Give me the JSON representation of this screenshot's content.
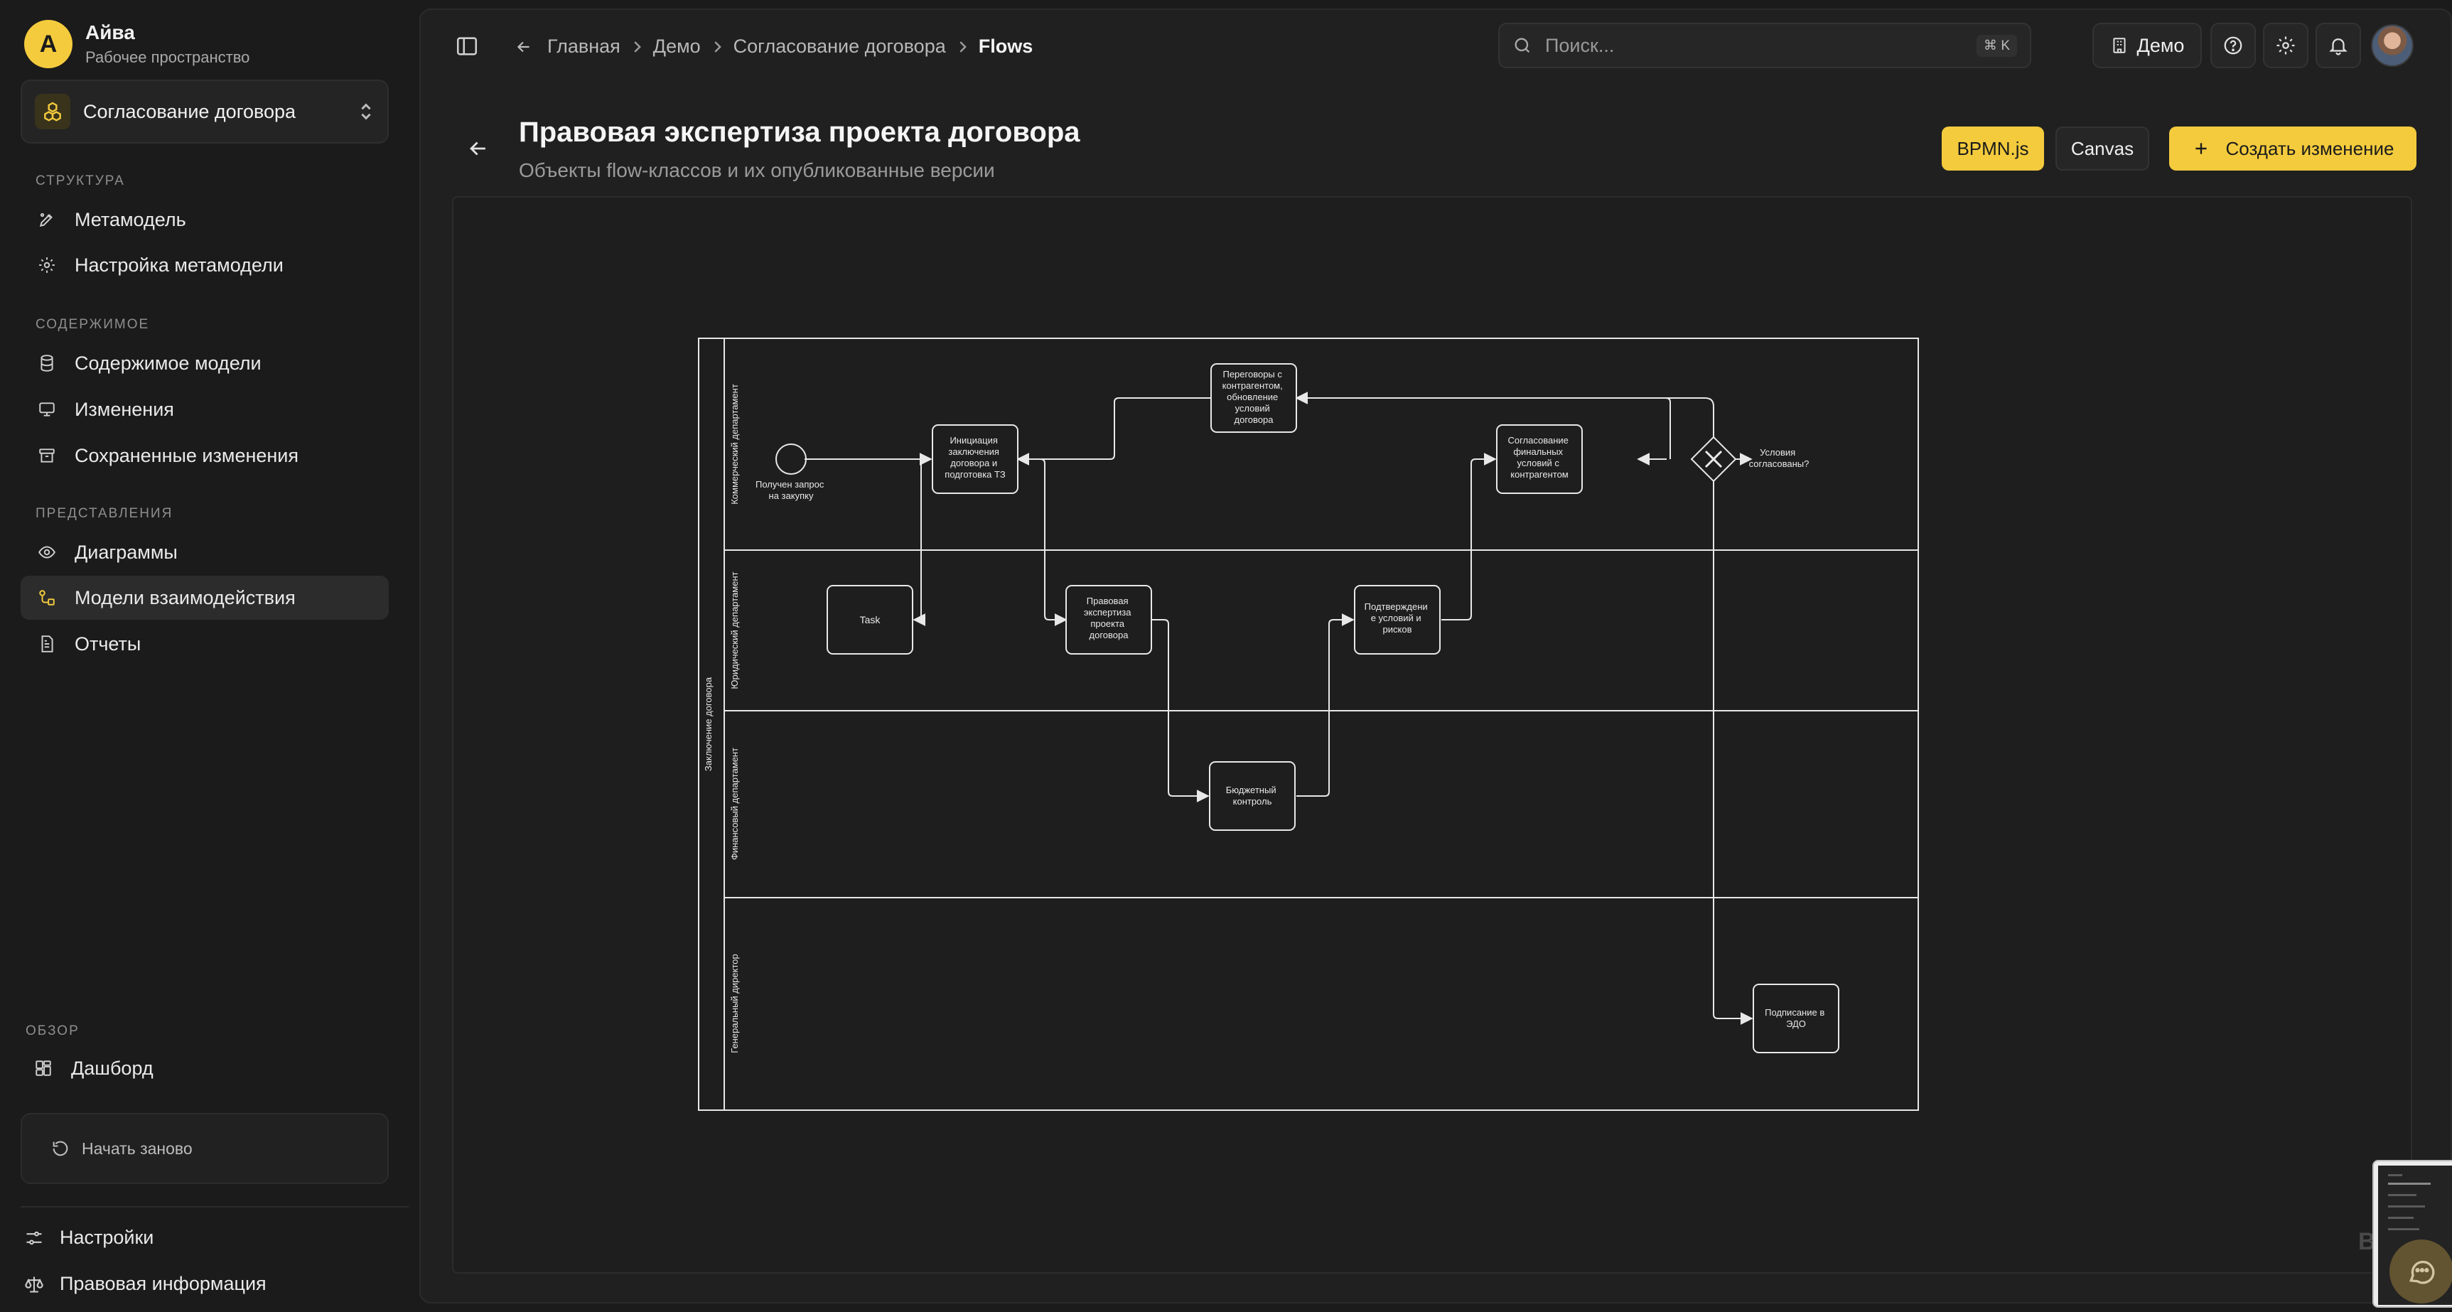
{
  "workspace": {
    "initial": "А",
    "name": "Айва",
    "subtitle": "Рабочее пространство"
  },
  "project": {
    "name": "Согласование договора",
    "icon": "cubes-icon"
  },
  "sidebar": {
    "sections": [
      {
        "label": "СТРУКТУРА",
        "items": [
          {
            "label": "Метамодель",
            "icon": "metamodel-icon"
          },
          {
            "label": "Настройка метамодели",
            "icon": "gear-icon"
          }
        ]
      },
      {
        "label": "СОДЕРЖИМОЕ",
        "items": [
          {
            "label": "Содержимое модели",
            "icon": "database-icon"
          },
          {
            "label": "Изменения",
            "icon": "changes-icon"
          },
          {
            "label": "Сохраненные изменения",
            "icon": "archive-icon"
          }
        ]
      },
      {
        "label": "ПРЕДСТАВЛЕНИЯ",
        "items": [
          {
            "label": "Диаграммы",
            "icon": "eye-icon"
          },
          {
            "label": "Модели взаимодействия",
            "icon": "interaction-icon",
            "active": true
          },
          {
            "label": "Отчеты",
            "icon": "report-icon"
          }
        ]
      }
    ],
    "overview": {
      "label": "ОБЗОР",
      "items": [
        {
          "label": "Дашборд",
          "icon": "dashboard-icon"
        }
      ]
    },
    "restart_label": "Начать заново",
    "footer": [
      {
        "label": "Настройки",
        "icon": "sliders-icon"
      },
      {
        "label": "Правовая информация",
        "icon": "scales-icon"
      }
    ]
  },
  "breadcrumb": [
    "Главная",
    "Демо",
    "Согласование договора",
    "Flows"
  ],
  "search": {
    "placeholder": "Поиск...",
    "shortcut": "⌘ K"
  },
  "topbar": {
    "demo_label": "Демо"
  },
  "header": {
    "title": "Правовая экспертиза проекта договора",
    "subtitle": "Объекты flow-классов и их опубликованные версии"
  },
  "buttons": {
    "bpmn": "BPMN.js",
    "canvas": "Canvas",
    "create": "Создать изменение"
  },
  "diagram": {
    "pool": "Заключение договора",
    "lanes": [
      "Коммерческий департамент",
      "Юридический департамент",
      "Финансовый департамент",
      "Генеральный директор"
    ],
    "start_event": [
      "Получен запрос",
      "на закупку"
    ],
    "tasks": {
      "initiation": [
        "Инициация",
        "заключения",
        "договора и",
        "подготовка ТЗ"
      ],
      "negotiation": [
        "Переговоры с",
        "контрагентом,",
        "обновление",
        "условий",
        "договора"
      ],
      "final_approval": [
        "Согласование",
        "финальных",
        "условий с",
        "контрагентом"
      ],
      "task": [
        "Task"
      ],
      "legal_review": [
        "Правовая",
        "экспертиза",
        "проекта",
        "договора"
      ],
      "confirm_risks": [
        "Подтверждени",
        "е условий и",
        "рисков"
      ],
      "budget_control": [
        "Бюджетный",
        "контроль"
      ],
      "sign_edo": [
        "Подписание в",
        "ЭДО"
      ]
    },
    "gateway_label": [
      "Условия",
      "согласованы?"
    ]
  },
  "watermark": "BPMN"
}
